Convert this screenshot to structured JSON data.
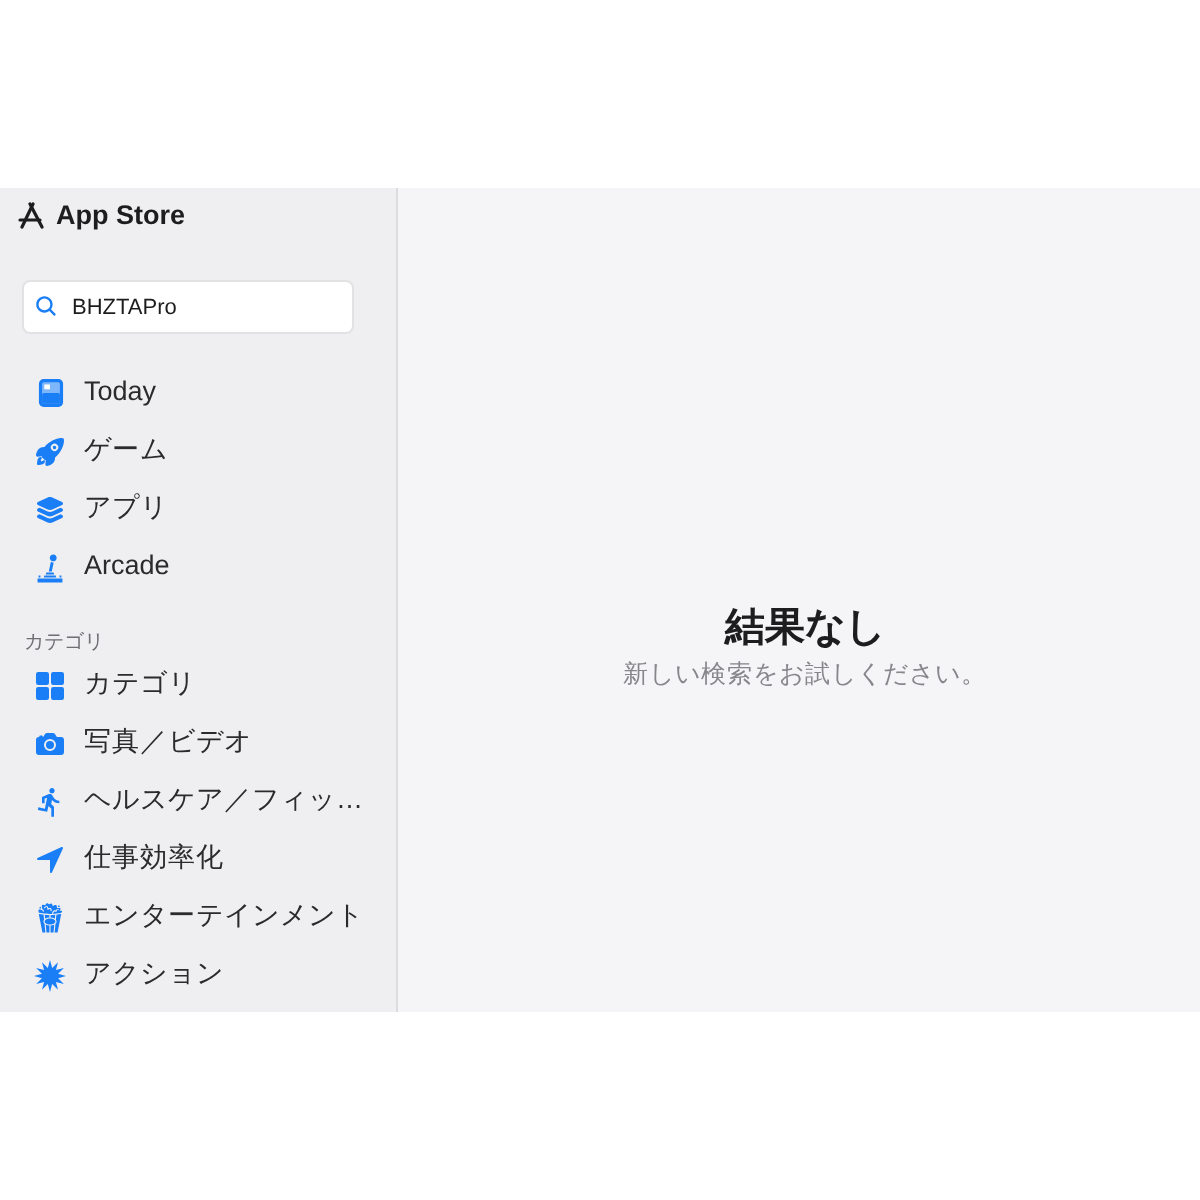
{
  "sidebar": {
    "title": "App Store",
    "search": {
      "value": "BHZTAPro"
    },
    "items": [
      {
        "label": "Today",
        "selected": false
      },
      {
        "label": "ゲーム",
        "selected": false
      },
      {
        "label": "アプリ",
        "selected": false
      },
      {
        "label": "Arcade",
        "selected": false
      }
    ],
    "section": {
      "heading": "カテゴリ",
      "items": [
        {
          "label": "カテゴリ",
          "selected": false
        },
        {
          "label": "写真／ビデオ",
          "selected": false
        },
        {
          "label": "ヘルスケア／フィッ…",
          "selected": false
        },
        {
          "label": "仕事効率化",
          "selected": false
        },
        {
          "label": "エンターテインメント",
          "selected": false
        },
        {
          "label": "アクション",
          "selected": false
        }
      ]
    }
  },
  "main": {
    "title": "結果なし",
    "message": "新しい検索をお試しください。"
  }
}
